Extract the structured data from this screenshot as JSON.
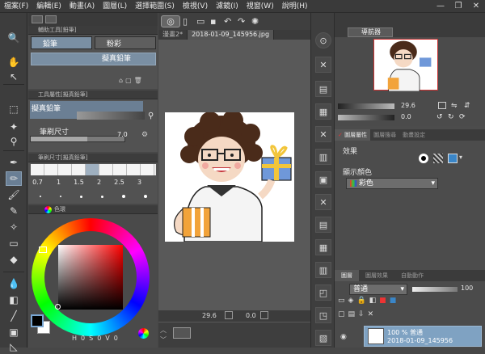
{
  "menu": {
    "items": [
      "檔案(F)",
      "編輯(E)",
      "動畫(A)",
      "圖層(L)",
      "選擇範圍(S)",
      "檢視(V)",
      "濾鏡(I)",
      "視窗(W)",
      "說明(H)"
    ],
    "minimize": "—",
    "restore": "❐",
    "close": "✕"
  },
  "sub_tool_panel": {
    "title": "輔助工具[鉛筆]",
    "tab_pencil": "鉛筆",
    "tab_pastel": "粉彩",
    "selected_brush": "擬真鉛筆"
  },
  "tool_property_panel": {
    "title": "工具屬性[擬真鉛筆]",
    "brush_name": "擬真鉛筆",
    "brush_size_label": "筆刷尺寸",
    "brush_size_value": "7.0"
  },
  "brush_size_panel": {
    "title": "筆刷尺寸[擬真鉛筆]",
    "sizes": [
      "0.7",
      "1",
      "1.5",
      "2",
      "2.5",
      "3"
    ]
  },
  "color_panel": {
    "title": "色環",
    "readout_h": "0",
    "readout_s": "0",
    "readout_v": "0",
    "label_h": "H",
    "label_s": "S",
    "label_v": "V"
  },
  "canvas": {
    "tab_1": "漫畫2*",
    "tab_2": "2018-01-09_145956.jpg",
    "zoom": "29.6",
    "rotation": "0.0"
  },
  "navigator": {
    "tab": "導航器",
    "zoom": "29.6",
    "angle": "0.0"
  },
  "layer_property": {
    "tab_1": "圖層屬性",
    "tab_2": "圖層搜尋",
    "tab_3": "動畫設定",
    "effect_label": "效果",
    "display_color_label": "顯示顏色",
    "display_color_value": "彩色"
  },
  "layers": {
    "tab_1": "圖層",
    "tab_2": "圖層效果",
    "tab_3": "自動動作",
    "blend_mode": "普通",
    "opacity": "100",
    "layer_name": "100 % 普通",
    "layer_file": "2018-01-09_145956"
  },
  "colors": {
    "accent": "#7a8fa3",
    "layer_selected": "#7fa2c2",
    "orange": "#f2a33a",
    "gift_blue": "#6f98d9"
  }
}
